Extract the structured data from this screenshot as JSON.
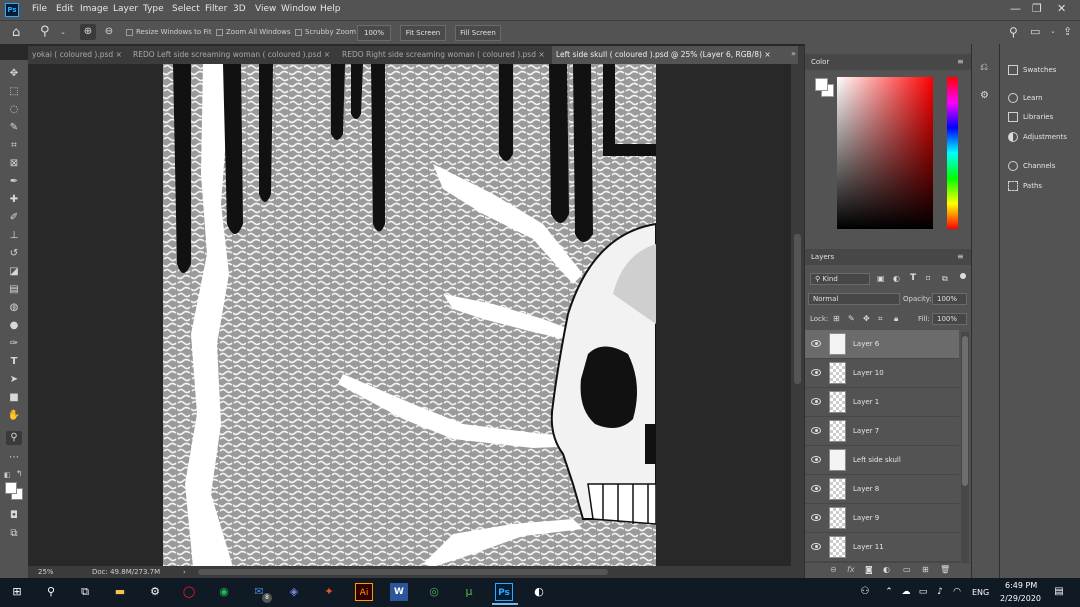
{
  "menubar": {
    "logo": "Ps",
    "items": [
      "File",
      "Edit",
      "Image",
      "Layer",
      "Type",
      "Select",
      "Filter",
      "3D",
      "View",
      "Window",
      "Help"
    ]
  },
  "options": {
    "resize_windows": "Resize Windows to Fit",
    "zoom_all": "Zoom All Windows",
    "scrubby_zoom": "Scrubby Zoom",
    "zoom_value": "100%",
    "fit_screen": "Fit Screen",
    "fill_screen": "Fill Screen"
  },
  "tabs": [
    "yokai ( coloured ).psd",
    "REDO Left side screaming woman ( coloured ).psd",
    "REDO Right side screaming woman ( coloured ).psd",
    "Left side skull ( coloured ).psd @ 25% (Layer 6, RGB/8)"
  ],
  "tab_close": "×",
  "status": {
    "zoom": "25%",
    "doc": "Doc: 49.8M/273.7M",
    "arrow": "›"
  },
  "color_panel": {
    "title": "Color"
  },
  "layers_panel": {
    "title": "Layers",
    "kind": "Kind",
    "blend_mode": "Normal",
    "opacity_label": "Opacity:",
    "opacity_value": "100%",
    "lock_label": "Lock:",
    "fill_label": "Fill:",
    "fill_value": "100%",
    "layers": [
      {
        "name": "Layer 6",
        "selected": true,
        "thumb": "plain"
      },
      {
        "name": "Layer 10",
        "selected": false,
        "thumb": "checker"
      },
      {
        "name": "Layer 1",
        "selected": false,
        "thumb": "checker"
      },
      {
        "name": "Layer 7",
        "selected": false,
        "thumb": "checker"
      },
      {
        "name": "Left side skull",
        "selected": false,
        "thumb": "plain"
      },
      {
        "name": "Layer 8",
        "selected": false,
        "thumb": "checker"
      },
      {
        "name": "Layer 9",
        "selected": false,
        "thumb": "checker"
      },
      {
        "name": "Layer 11",
        "selected": false,
        "thumb": "checker"
      }
    ]
  },
  "far_panel": {
    "swatches": "Swatches",
    "learn": "Learn",
    "libraries": "Libraries",
    "adjustments": "Adjustments",
    "channels": "Channels",
    "paths": "Paths"
  },
  "taskbar": {
    "mail_badge": "8",
    "ai_label": "Ai",
    "word_label": "W",
    "ps_label": "Ps",
    "language": "ENG",
    "time": "6:49 PM",
    "date": "2/29/2020"
  },
  "colors": {
    "ui_dark": "#535353",
    "workspace": "#282828",
    "taskbar": "#101a24",
    "accent": "#31a8ff"
  }
}
